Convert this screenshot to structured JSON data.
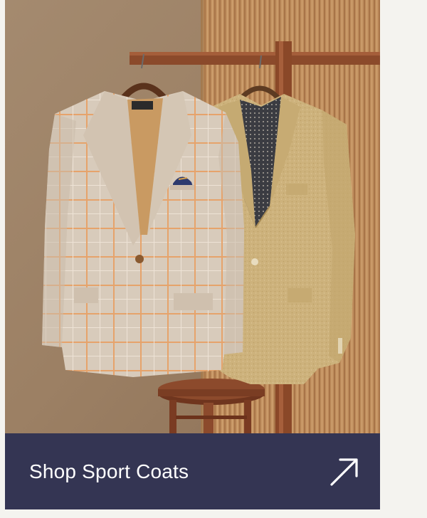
{
  "promo": {
    "image_alt": "Two sport coats hanging on wooden hangers from a wooden rack with a stool below",
    "cta_label": "Shop Sport Coats",
    "cta_icon": "arrow-up-right-icon"
  },
  "colors": {
    "cta_background": "#343553",
    "cta_text": "#ffffff",
    "page_background": "#f4f3ef"
  }
}
